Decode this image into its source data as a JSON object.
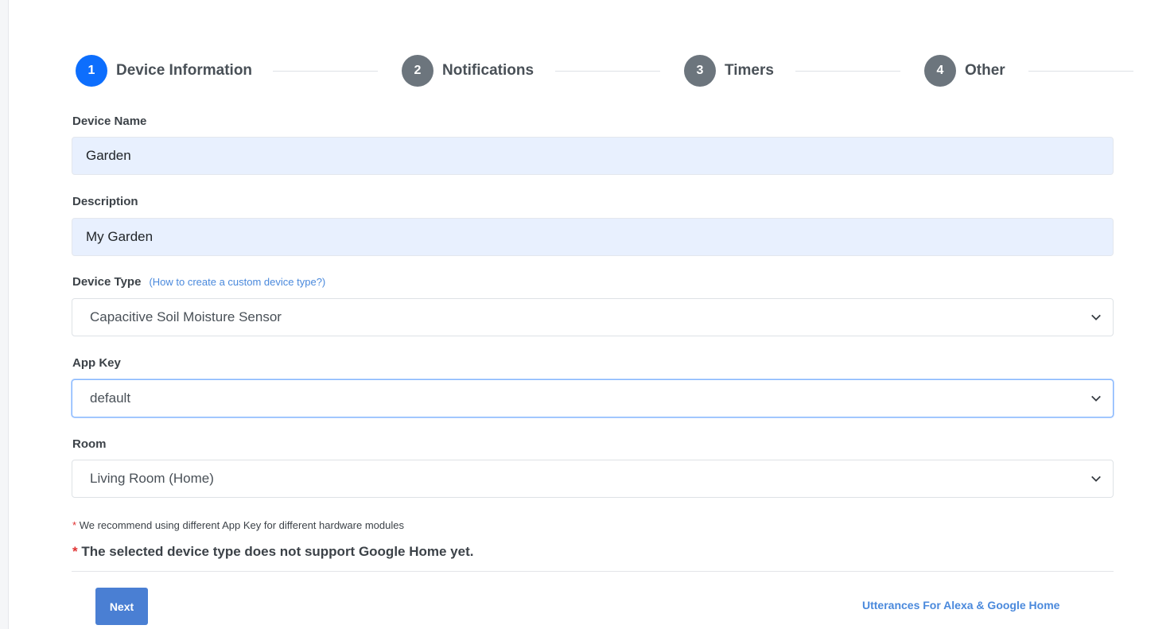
{
  "stepper": {
    "steps": [
      {
        "num": "1",
        "label": "Device Information"
      },
      {
        "num": "2",
        "label": "Notifications"
      },
      {
        "num": "3",
        "label": "Timers"
      },
      {
        "num": "4",
        "label": "Other"
      }
    ],
    "active_step": 1
  },
  "form": {
    "device_name": {
      "label": "Device Name",
      "value": "Garden"
    },
    "description": {
      "label": "Description",
      "value": "My Garden"
    },
    "device_type": {
      "label": "Device Type",
      "help_link": "(How to create a custom device type?)",
      "selected": "Capacitive Soil Moisture Sensor"
    },
    "app_key": {
      "label": "App Key",
      "selected": "default"
    },
    "room": {
      "label": "Room",
      "selected": "Living Room (Home)"
    }
  },
  "notes": {
    "star": "*",
    "app_key_note": "We recommend using different App Key for different hardware modules",
    "google_home_note": "The selected device type does not support Google Home yet."
  },
  "footer": {
    "next_label": "Next",
    "utterances_link": "Utterances For Alexa & Google Home"
  },
  "colors": {
    "active_step": "#0d6efd",
    "inactive_step": "#6c757d",
    "primary_button": "#4a7fd3",
    "link": "#4a89dc",
    "required_star": "#e03131",
    "autofill_bg": "#e8f0fe"
  }
}
